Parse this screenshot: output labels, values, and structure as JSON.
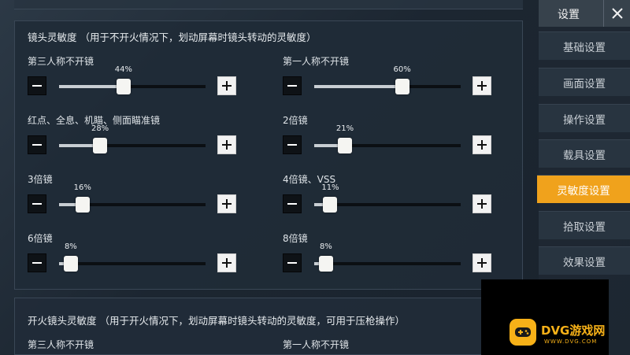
{
  "section_main": {
    "title": "镜头灵敏度  （用于不开火情况下，划动屏幕时镜头转动的灵敏度）"
  },
  "sliders": [
    {
      "label": "第三人称不开镜",
      "percent_text": "44%",
      "value": 44
    },
    {
      "label": "第一人称不开镜",
      "percent_text": "60%",
      "value": 60
    },
    {
      "label": "红点、全息、机瞄、侧面瞄准镜",
      "percent_text": "28%",
      "value": 28
    },
    {
      "label": "2倍镜",
      "percent_text": "21%",
      "value": 21
    },
    {
      "label": "3倍镜",
      "percent_text": "16%",
      "value": 16
    },
    {
      "label": "4倍镜、VSS",
      "percent_text": "11%",
      "value": 11
    },
    {
      "label": "6倍镜",
      "percent_text": "8%",
      "value": 8
    },
    {
      "label": "8倍镜",
      "percent_text": "8%",
      "value": 8
    }
  ],
  "section_fire": {
    "title": "开火镜头灵敏度  （用于开火情况下，划动屏幕时镜头转动的灵敏度，可用于压枪操作）",
    "partial_labels": [
      "第三人称不开镜",
      "第一人称不开镜"
    ]
  },
  "sidebar": {
    "title": "设置",
    "close_icon": "close-icon",
    "items": [
      {
        "label": "基础设置",
        "active": false
      },
      {
        "label": "画面设置",
        "active": false
      },
      {
        "label": "操作设置",
        "active": false
      },
      {
        "label": "载具设置",
        "active": false
      },
      {
        "label": "灵敏度设置",
        "active": true
      },
      {
        "label": "拾取设置",
        "active": false
      },
      {
        "label": "效果设置",
        "active": false
      }
    ]
  },
  "watermark": {
    "name": "DVG游戏网",
    "url": "WWW.DVG.COM"
  },
  "colors": {
    "accent": "#f0a21c",
    "panel": "#202b37",
    "watermark": "#f7b118"
  }
}
